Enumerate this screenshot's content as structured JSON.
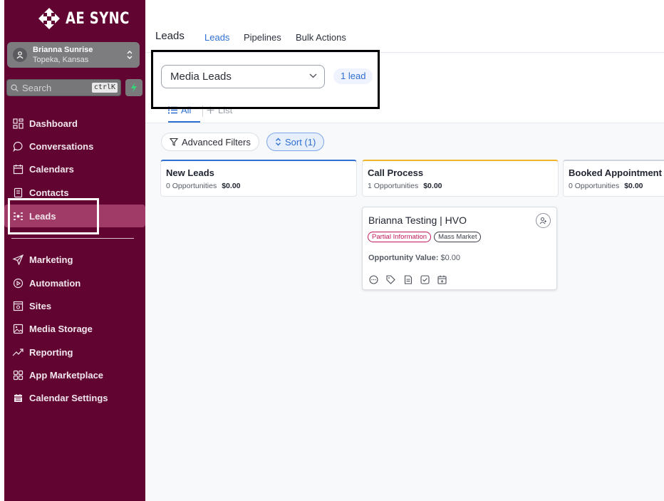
{
  "brand": {
    "name": "AE SYNC",
    "sidebar_color": "#620431",
    "accent": "#2f6fd0"
  },
  "location": {
    "name": "Brianna Sunrise",
    "city": "Topeka, Kansas"
  },
  "search": {
    "placeholder": "Search",
    "shortcut": "ctrlK"
  },
  "sidebar": {
    "items": [
      {
        "label": "Dashboard",
        "icon": "grid-icon"
      },
      {
        "label": "Conversations",
        "icon": "chat-bubble-icon"
      },
      {
        "label": "Calendars",
        "icon": "calendar-icon"
      },
      {
        "label": "Contacts",
        "icon": "contact-card-icon"
      },
      {
        "label": "Leads",
        "icon": "leads-icon",
        "active": true
      },
      {
        "label": "Marketing",
        "icon": "send-icon"
      },
      {
        "label": "Automation",
        "icon": "play-circle-icon"
      },
      {
        "label": "Sites",
        "icon": "sites-icon"
      },
      {
        "label": "Media Storage",
        "icon": "image-icon"
      },
      {
        "label": "Reporting",
        "icon": "trend-icon"
      },
      {
        "label": "App Marketplace",
        "icon": "apps-icon"
      },
      {
        "label": "Calendar Settings",
        "icon": "calendar-filled-icon"
      }
    ]
  },
  "header": {
    "title": "Leads",
    "tabs": [
      {
        "label": "Leads",
        "active": true
      },
      {
        "label": "Pipelines",
        "active": false
      },
      {
        "label": "Bulk Actions",
        "active": false
      }
    ]
  },
  "pipeline": {
    "selected": "Media Leads",
    "count_label": "1 lead"
  },
  "views": {
    "all_label": "All",
    "list_label": "List"
  },
  "toolbar": {
    "filters_label": "Advanced Filters",
    "sort_label": "Sort (1)"
  },
  "stages": [
    {
      "title": "New Leads",
      "opportunities": "0 Opportunities",
      "amount": "$0.00",
      "top_color": "#2f6fd0"
    },
    {
      "title": "Call Process",
      "opportunities": "1 Opportunities",
      "amount": "$0.00",
      "top_color": "#f0b429"
    },
    {
      "title": "Booked Appointment",
      "opportunities": "0 Opportunities",
      "amount": "$0.00",
      "top_color": "#cfd4dc"
    }
  ],
  "opportunity": {
    "title": "Brianna Testing | HVO",
    "tags": [
      "Partial Information",
      "Mass Market"
    ],
    "value_label": "Opportunity Value:",
    "value": "$0.00"
  }
}
